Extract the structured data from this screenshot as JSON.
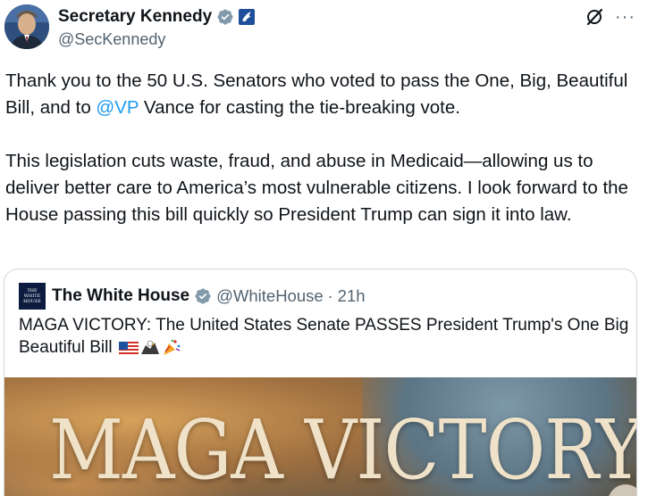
{
  "tweet": {
    "author": {
      "display_name": "Secretary Kennedy",
      "handle": "@SecKennedy",
      "verified_icon": "verified-badge-icon",
      "affiliation_icon": "hhs-eagle-icon"
    },
    "paragraphs": [
      {
        "before": "Thank you to the 50 U.S. Senators who voted to pass the One, Big, Beautiful Bill, and to ",
        "mention": "@VP",
        "after": " Vance for casting the tie-breaking vote."
      },
      {
        "text": "This legislation cuts waste, fraud, and abuse in Medicaid—allowing us to deliver better care to America’s most vulnerable citizens. I look forward to the House passing this bill quickly so President Trump can sign it into law."
      }
    ],
    "icons": {
      "grok": "grok-icon",
      "more": "···"
    }
  },
  "quote": {
    "avatar_text": [
      "THE",
      "WHITE",
      "HOUSE"
    ],
    "display_name": "The White House",
    "handle": "@WhiteHouse",
    "separator": "·",
    "time": "21h",
    "text": "MAGA VICTORY: The United States Senate PASSES President Trump's One Big Beautiful Bill",
    "emojis": [
      "us-flag-emoji",
      "eagle-emoji",
      "party-popper-emoji"
    ],
    "media_title": "MAGA VICTORY"
  },
  "colors": {
    "link": "#1d9bf0",
    "verified_grey": "#829aab",
    "secondary_text": "#536471",
    "border": "#cfd9de"
  }
}
